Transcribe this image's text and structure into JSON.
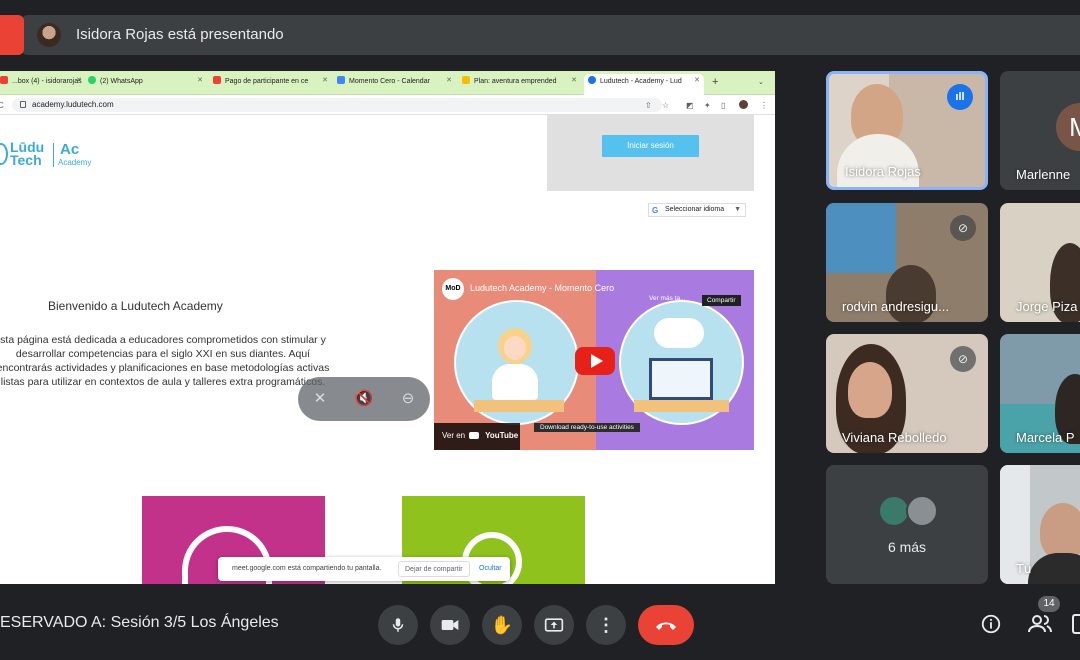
{
  "presenter_bar": {
    "text": "Isidora Rojas está presentando"
  },
  "browser": {
    "tabs": [
      {
        "label": "...box (4) - isidorarojas",
        "icon_color": "#ea4335"
      },
      {
        "label": "(2) WhatsApp",
        "icon_color": "#25d366"
      },
      {
        "label": "Pago de participante en ce",
        "icon_color": "#ea4335"
      },
      {
        "label": "Momento Cero - Calendar",
        "icon_color": "#4285f4"
      },
      {
        "label": "Plan: aventura emprended",
        "icon_color": "#fbbc04"
      },
      {
        "label": "Ludutech - Academy - Lud",
        "icon_color": "#1a73e8"
      }
    ],
    "url": "academy.ludutech.com"
  },
  "site": {
    "logo_line1": "Lūdu",
    "logo_line2": "Tech",
    "logo_ac": "Ac",
    "logo_academy": "Academy",
    "login_button": "Iniciar sesión",
    "language_select": "Seleccionar idioma",
    "welcome_title": "Bienvenido a Ludutech Academy",
    "welcome_body": "sta página está dedicada a educadores comprometidos con stimular y desarrollar competencias para el siglo XXI en sus diantes. Aquí encontrarás actividades y planificaciones en base metodologías activas listas para utilizar en contextos de aula y talleres extra programáticos.",
    "video": {
      "title": "Ludutech Academy - Momento Cero",
      "channel_badge": "MoD",
      "watch_later": "Ver más ta...",
      "share_tooltip": "Compartir",
      "download_label": "Download ready-to-use activities",
      "watch_on": "Ver en",
      "youtube": "YouTube"
    }
  },
  "share_notice": {
    "message": "meet.google.com está compartiendo tu pantalla.",
    "stop_button": "Dejar de compartir",
    "hide_button": "Ocultar"
  },
  "participants": [
    {
      "name": "Isidora Rojas"
    },
    {
      "name": "Marlenne",
      "initial": "M"
    },
    {
      "name": "rodvin andresigu..."
    },
    {
      "name": "Jorge Piza"
    },
    {
      "name": "Viviana Rebolledo"
    },
    {
      "name": "Marcela P"
    },
    {
      "name": "6 más"
    },
    {
      "name": "Tú"
    }
  ],
  "bottom": {
    "meeting_title": "ESERVADO A: Sesión 3/5 Los Ángeles",
    "participant_count": "14"
  },
  "colors": {
    "background": "#202124",
    "end_call": "#ea4335",
    "active_speaker": "#8ab4f8",
    "tab_strip": "#d8f3c0"
  }
}
